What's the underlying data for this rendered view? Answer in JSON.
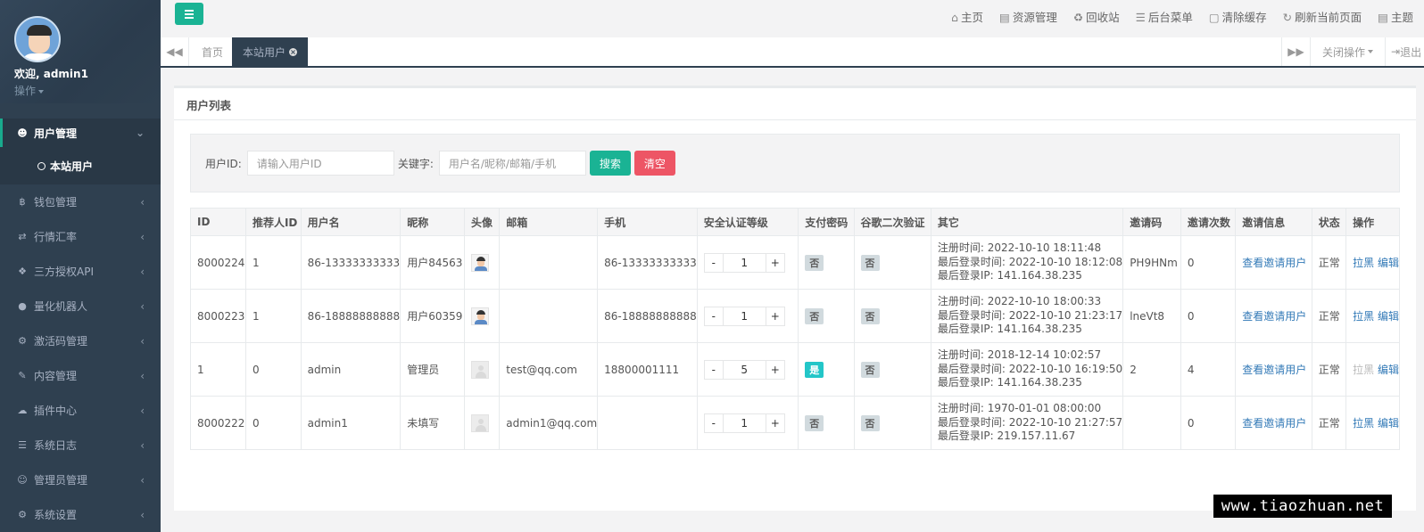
{
  "sidebar": {
    "welcome": "欢迎, admin1",
    "operation": "操作",
    "menu": [
      {
        "label": "用户管理",
        "icon": "users-icon"
      },
      {
        "label": "钱包管理",
        "icon": "bitcoin-icon"
      },
      {
        "label": "行情汇率",
        "icon": "exchange-icon"
      },
      {
        "label": "三方授权API",
        "icon": "cube-icon"
      },
      {
        "label": "量化机器人",
        "icon": "robot-icon"
      },
      {
        "label": "激活码管理",
        "icon": "gear-icon"
      },
      {
        "label": "内容管理",
        "icon": "edit-icon"
      },
      {
        "label": "插件中心",
        "icon": "cloud-icon"
      },
      {
        "label": "系统日志",
        "icon": "database-icon"
      },
      {
        "label": "管理员管理",
        "icon": "user-circle-icon"
      },
      {
        "label": "系统设置",
        "icon": "cogs-icon"
      }
    ],
    "submenu_active": "本站用户"
  },
  "topbar": {
    "links": [
      {
        "label": "主页",
        "icon": "home-icon"
      },
      {
        "label": "资源管理",
        "icon": "file-icon"
      },
      {
        "label": "回收站",
        "icon": "recycle-icon"
      },
      {
        "label": "后台菜单",
        "icon": "list-icon"
      },
      {
        "label": "清除缓存",
        "icon": "trash-icon"
      },
      {
        "label": "刷新当前页面",
        "icon": "refresh-icon"
      },
      {
        "label": "主题",
        "icon": "theme-icon"
      }
    ]
  },
  "tabs": {
    "home": "首页",
    "current": "本站用户",
    "close_ops": "关闭操作",
    "logout": "退出"
  },
  "panel": {
    "title": "用户列表",
    "filter": {
      "user_id_label": "用户ID:",
      "user_id_placeholder": "请输入用户ID",
      "keyword_label": "关键字:",
      "keyword_placeholder": "用户名/昵称/邮箱/手机",
      "search_btn": "搜索",
      "clear_btn": "清空"
    },
    "columns": [
      "ID",
      "推荐人ID",
      "用户名",
      "昵称",
      "头像",
      "邮箱",
      "手机",
      "安全认证等级",
      "支付密码",
      "谷歌二次验证",
      "其它",
      "邀请码",
      "邀请次数",
      "邀请信息",
      "状态",
      "操作"
    ],
    "rows": [
      {
        "id": "8000224",
        "ref": "1",
        "username": "86-13333333333",
        "nick": "用户84563",
        "avatar": "photo",
        "email": "",
        "phone": "86-13333333333",
        "level": "1",
        "pay": "否",
        "google": "否",
        "reg": "注册时间: 2022-10-10 18:11:48",
        "last": "最后登录时间: 2022-10-10 18:12:08",
        "ip": "最后登录IP: 141.164.38.235",
        "code": "PH9HNm",
        "count": "0",
        "invite": "查看邀请用户",
        "status": "正常",
        "block": "拉黑",
        "edit": "编辑"
      },
      {
        "id": "8000223",
        "ref": "1",
        "username": "86-18888888888",
        "nick": "用户60359",
        "avatar": "photo",
        "email": "",
        "phone": "86-18888888888",
        "level": "1",
        "pay": "否",
        "google": "否",
        "reg": "注册时间: 2022-10-10 18:00:33",
        "last": "最后登录时间: 2022-10-10 21:23:17",
        "ip": "最后登录IP: 141.164.38.235",
        "code": "lneVt8",
        "count": "0",
        "invite": "查看邀请用户",
        "status": "正常",
        "block": "拉黑",
        "edit": "编辑"
      },
      {
        "id": "1",
        "ref": "0",
        "username": "admin",
        "nick": "管理员",
        "avatar": "default",
        "email": "test@qq.com",
        "phone": "18800001111",
        "level": "5",
        "pay": "是",
        "google": "否",
        "reg": "注册时间: 2018-12-14 10:02:57",
        "last": "最后登录时间: 2022-10-10 16:19:50",
        "ip": "最后登录IP: 141.164.38.235",
        "code": "2",
        "count": "4",
        "invite": "查看邀请用户",
        "status": "正常",
        "block": "拉黑",
        "edit": "编辑"
      },
      {
        "id": "8000222",
        "ref": "0",
        "username": "admin1",
        "nick": "未填写",
        "avatar": "default",
        "email": "admin1@qq.com",
        "phone": "",
        "level": "1",
        "pay": "否",
        "google": "否",
        "reg": "注册时间: 1970-01-01 08:00:00",
        "last": "最后登录时间: 2022-10-10 21:27:57",
        "ip": "最后登录IP: 219.157.11.67",
        "code": "",
        "count": "0",
        "invite": "查看邀请用户",
        "status": "正常",
        "block": "拉黑",
        "edit": "编辑"
      }
    ]
  },
  "watermark": "www.tiaozhuan.net",
  "colors": {
    "sidebar": "#2f4050",
    "accent": "#1ab394",
    "danger": "#ed5565",
    "info": "#23c6c8",
    "link": "#337ab7"
  }
}
